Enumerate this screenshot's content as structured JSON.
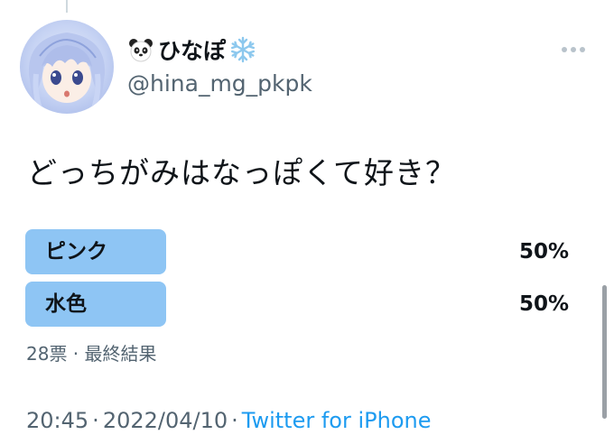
{
  "author": {
    "display_name": "ひなぽ",
    "handle": "@hina_mg_pkpk",
    "emoji_before": "panda-face-icon",
    "emoji_after": "snowflake-icon"
  },
  "tweet": {
    "text": "どっちがみはなっぽくて好き？"
  },
  "poll": {
    "options": [
      {
        "label": "ピンク",
        "percent": "50%",
        "fraction": 0.5
      },
      {
        "label": "水色",
        "percent": "50%",
        "fraction": 0.5
      }
    ],
    "meta": "28票 · 最終結果",
    "bar_color": "#8ec5f4"
  },
  "footer": {
    "time": "20:45",
    "separator": "·",
    "date": "2022/04/10",
    "source": "Twitter for iPhone"
  },
  "colors": {
    "accent": "#1d9bf0",
    "secondary_text": "#536471"
  }
}
